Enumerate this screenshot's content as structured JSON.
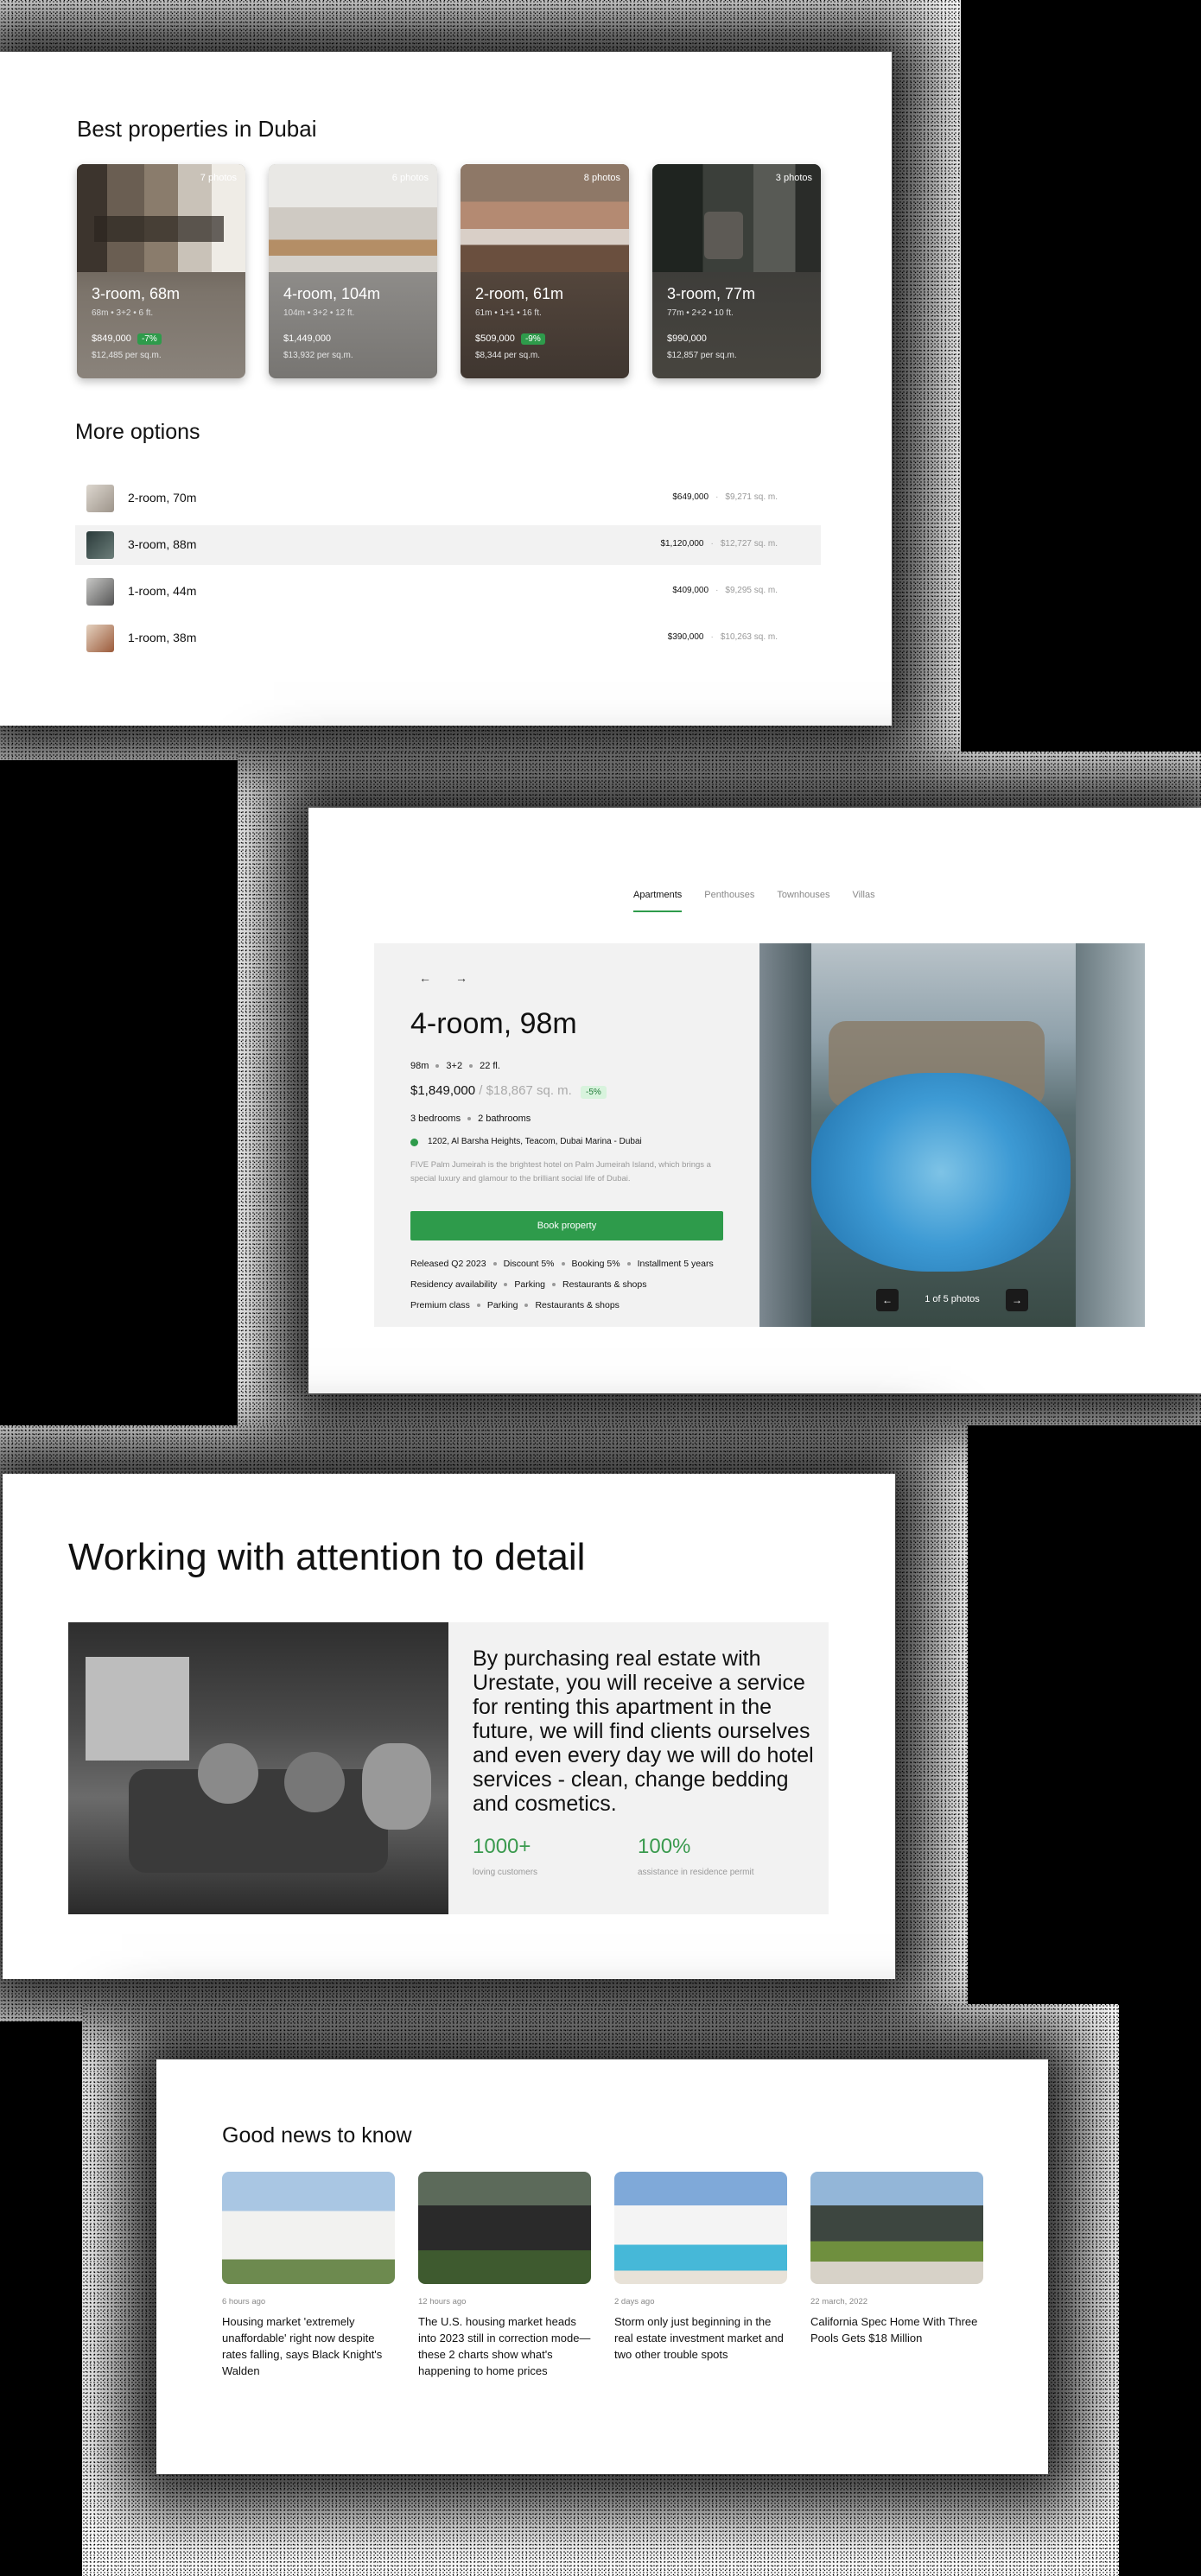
{
  "best": {
    "title": "Best properties in Dubai",
    "cards": [
      {
        "title": "3-room, 68m",
        "specs": "68m • 3+2 • 6 ft.",
        "price": "$849,000",
        "discount": "-7%",
        "per_sqm": "$12,485 per sq.m.",
        "photos": "7 photos"
      },
      {
        "title": "4-room, 104m",
        "specs": "104m • 3+2 • 12 ft.",
        "price": "$1,449,000",
        "discount": "",
        "per_sqm": "$13,932 per sq.m.",
        "photos": "6 photos"
      },
      {
        "title": "2-room, 61m",
        "specs": "61m • 1+1 • 16 ft.",
        "price": "$509,000",
        "discount": "-9%",
        "per_sqm": "$8,344 per sq.m.",
        "photos": "8 photos"
      },
      {
        "title": "3-room, 77m",
        "specs": "77m • 2+2 • 10 ft.",
        "price": "$990,000",
        "discount": "",
        "per_sqm": "$12,857 per sq.m.",
        "photos": "3 photos"
      }
    ]
  },
  "more": {
    "title": "More options",
    "rows": [
      {
        "name": "2-room, 70m",
        "price": "$649,000",
        "per_sqm": "$9,271 sq. m."
      },
      {
        "name": "3-room, 88m",
        "price": "$1,120,000",
        "per_sqm": "$12,727 sq. m."
      },
      {
        "name": "1-room, 44m",
        "price": "$409,000",
        "per_sqm": "$9,295 sq. m."
      },
      {
        "name": "1-room, 38m",
        "price": "$390,000",
        "per_sqm": "$10,263 sq. m."
      }
    ]
  },
  "detail": {
    "tabs": [
      "Apartments",
      "Penthouses",
      "Townhouses",
      "Villas"
    ],
    "active_tab": "Apartments",
    "title": "4-room, 98m",
    "specs": [
      "98m",
      "3+2",
      "22 fl."
    ],
    "price": "$1,849,000",
    "old_price": "/ $18,867 sq. m.",
    "discount": "-5%",
    "rooms": [
      "3 bedrooms",
      "2 bathrooms"
    ],
    "address": "1202, Al Barsha Heights, Teacom, Dubai Marina - Dubai",
    "description": "FIVE Palm Jumeirah is the brightest hotel on Palm Jumeirah Island, which brings a special luxury and glamour to the brilliant social life of Dubai.",
    "book_label": "Book property",
    "features": [
      [
        "Released Q2 2023",
        "Discount 5%",
        "Booking 5%",
        "Installment 5 years"
      ],
      [
        "Residency availability",
        "Parking",
        "Restaurants & shops"
      ],
      [
        "Premium class",
        "Parking",
        "Restaurants & shops"
      ]
    ],
    "photo_counter": "1 of 5 photos"
  },
  "attention": {
    "title": "Working with attention to detail",
    "text": "By purchasing real estate with Urestate, you will receive a service for renting this apartment in the future, we will find clients ourselves and even every day we will do hotel services - clean, change bedding and cosmetics.",
    "stats": [
      {
        "value": "1000+",
        "label": "loving customers"
      },
      {
        "value": "100%",
        "label": "assistance in residence permit"
      }
    ]
  },
  "news": {
    "title": "Good news to know",
    "items": [
      {
        "time": "6 hours ago",
        "headline": "Housing market 'extremely unaffordable' right now despite rates falling, says Black Knight's Walden"
      },
      {
        "time": "12 hours ago",
        "headline": "The U.S. housing market heads into 2023 still in correction mode—these 2 charts show what's happening to home prices"
      },
      {
        "time": "2 days ago",
        "headline": "Storm only just beginning in the real estate investment market and two other trouble spots"
      },
      {
        "time": "22 march, 2022",
        "headline": "California Spec Home With Three Pools Gets $18 Million"
      }
    ]
  },
  "colors": {
    "accent": "#2e9b4b",
    "accent_text": "#3a9a4e",
    "badge_bg": "#d8f3dd",
    "panel": "#f2f2f2"
  }
}
